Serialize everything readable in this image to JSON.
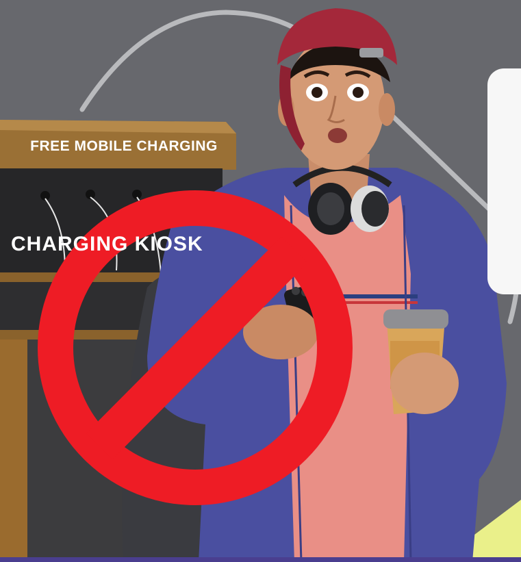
{
  "image": {
    "kiosk_sign": "FREE MOBILE CHARGING",
    "kiosk_panel": "CHARGING KIOSK",
    "symbol": "no-prohibition-sign",
    "colors": {
      "background": "#67686d",
      "prohibition_red": "#ee1c25",
      "hoodie": "#4a4fa0",
      "shirt": "#e98f86",
      "cap": "#a4283a",
      "kiosk_wood": "#9a7035",
      "accent_yellow": "#eaf08a",
      "bottom_band": "#4a3e8f"
    }
  }
}
